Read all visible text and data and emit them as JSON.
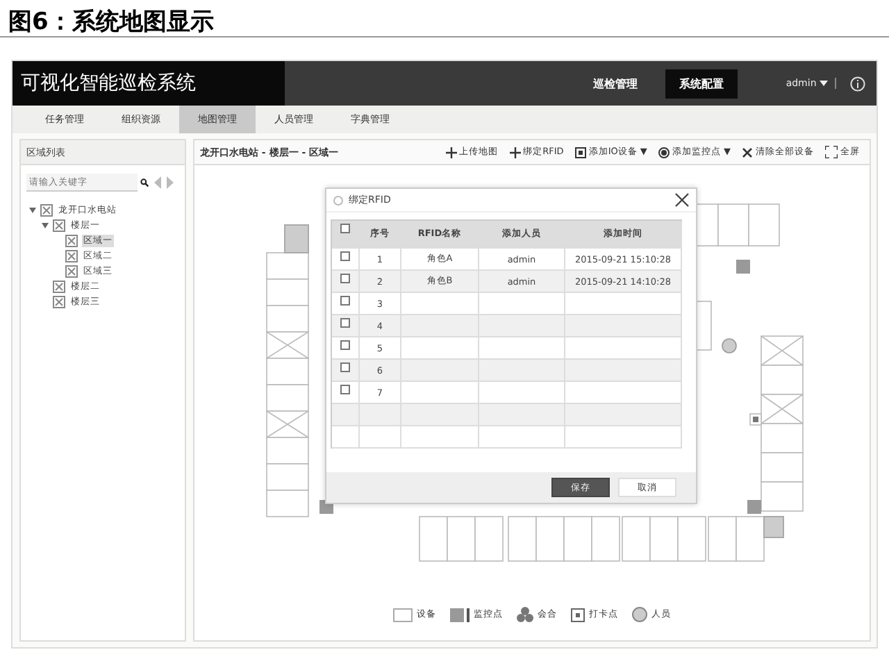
{
  "caption": "图6：系统地图显示",
  "header": {
    "title": "可视化智能巡检系统",
    "nav": [
      {
        "label": "巡检管理",
        "selected": false
      },
      {
        "label": "系统配置",
        "selected": true
      }
    ],
    "user": "admin"
  },
  "tabs": [
    {
      "label": "任务管理",
      "selected": false
    },
    {
      "label": "组织资源",
      "selected": false
    },
    {
      "label": "地图管理",
      "selected": true
    },
    {
      "label": "人员管理",
      "selected": false
    },
    {
      "label": "字典管理",
      "selected": false
    }
  ],
  "sidebar": {
    "title": "区域列表",
    "search": {
      "placeholder": "请输入关键字"
    },
    "tree": [
      {
        "label": "龙开口水电站",
        "selected": false,
        "expanded": true,
        "children": [
          {
            "label": "楼层一",
            "selected": false,
            "expanded": true,
            "children": [
              {
                "label": "区域一",
                "selected": true
              },
              {
                "label": "区域二",
                "selected": false
              },
              {
                "label": "区域三",
                "selected": false
              }
            ]
          },
          {
            "label": "楼层二",
            "selected": false
          },
          {
            "label": "楼层三",
            "selected": false
          }
        ]
      }
    ]
  },
  "map": {
    "breadcrumb": "龙开口水电站 - 楼层一 - 区域一",
    "toolbar": [
      {
        "kind": "plus",
        "label": "上传地图"
      },
      {
        "kind": "plus",
        "label": "绑定RFID"
      },
      {
        "kind": "io",
        "label": "添加IO设备 ▼"
      },
      {
        "kind": "camera",
        "label": "添加监控点 ▼"
      },
      {
        "kind": "clear",
        "label": "清除全部设备"
      },
      {
        "kind": "fullscreen",
        "label": "全屏"
      }
    ],
    "legend": [
      {
        "kind": "device",
        "label": "设备"
      },
      {
        "kind": "camera",
        "label": "监控点"
      },
      {
        "kind": "group",
        "label": "会合"
      },
      {
        "kind": "checkpoint",
        "label": "打卡点"
      },
      {
        "kind": "person",
        "label": "人员"
      }
    ]
  },
  "dialog": {
    "title": "绑定RFID",
    "header_checked": false,
    "columns": [
      "序号",
      "RFID名称",
      "添加人员",
      "添加时间"
    ],
    "rows": [
      {
        "checked": false,
        "cells": [
          "1",
          "角色A",
          "admin",
          "2015-09-21 15:10:28"
        ]
      },
      {
        "checked": false,
        "cells": [
          "2",
          "角色B",
          "admin",
          "2015-09-21 14:10:28"
        ]
      },
      {
        "checked": false,
        "cells": [
          "3"
        ]
      },
      {
        "checked": false,
        "cells": [
          "4"
        ]
      },
      {
        "checked": false,
        "cells": [
          "5"
        ]
      },
      {
        "checked": false,
        "cells": [
          "6"
        ]
      },
      {
        "checked": false,
        "cells": [
          "7"
        ]
      }
    ],
    "buttons": [
      {
        "kind": "primary",
        "label": "保存"
      },
      {
        "kind": "secondary",
        "label": "取消"
      }
    ]
  }
}
